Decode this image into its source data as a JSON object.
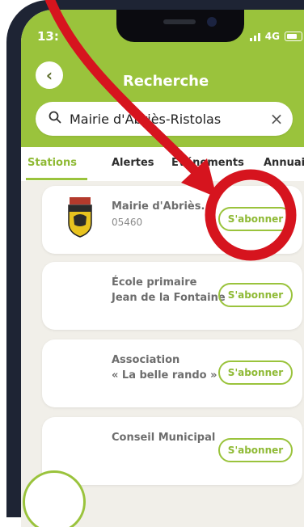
{
  "status": {
    "time": "13:",
    "network": "4G"
  },
  "header": {
    "title": "Recherche"
  },
  "search": {
    "value": "Mairie d'Abriès-Ristolas"
  },
  "tabs": [
    {
      "label": "Stations"
    },
    {
      "label": "Alertes"
    },
    {
      "label": "Événements"
    },
    {
      "label": "Annuaire"
    }
  ],
  "results": [
    {
      "name": "Mairie d'Abriès...",
      "code": "05460",
      "button": "S'abonner"
    },
    {
      "name_line1": "École primaire",
      "name_line2": "Jean de la Fontaine",
      "button": "S'abonner"
    },
    {
      "name_line1": "Association",
      "name_line2": "« La belle rando »",
      "button": "S'abonner"
    },
    {
      "name": "Conseil Municipal",
      "button": "S'abonner"
    }
  ],
  "colors": {
    "accent": "#9ac33c",
    "annotation": "#d6141e"
  }
}
